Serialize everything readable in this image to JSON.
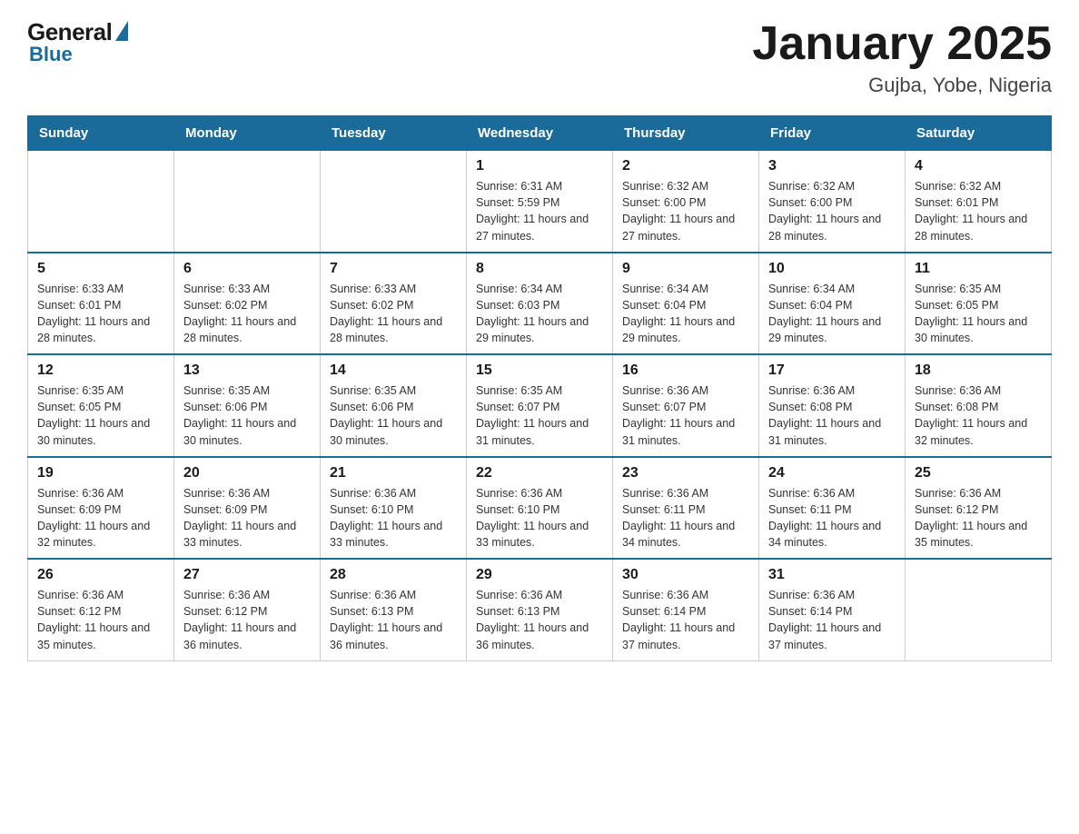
{
  "header": {
    "logo_general": "General",
    "logo_blue": "Blue",
    "title": "January 2025",
    "subtitle": "Gujba, Yobe, Nigeria"
  },
  "days_of_week": [
    "Sunday",
    "Monday",
    "Tuesday",
    "Wednesday",
    "Thursday",
    "Friday",
    "Saturday"
  ],
  "weeks": [
    [
      {
        "day": "",
        "info": ""
      },
      {
        "day": "",
        "info": ""
      },
      {
        "day": "",
        "info": ""
      },
      {
        "day": "1",
        "info": "Sunrise: 6:31 AM\nSunset: 5:59 PM\nDaylight: 11 hours and 27 minutes."
      },
      {
        "day": "2",
        "info": "Sunrise: 6:32 AM\nSunset: 6:00 PM\nDaylight: 11 hours and 27 minutes."
      },
      {
        "day": "3",
        "info": "Sunrise: 6:32 AM\nSunset: 6:00 PM\nDaylight: 11 hours and 28 minutes."
      },
      {
        "day": "4",
        "info": "Sunrise: 6:32 AM\nSunset: 6:01 PM\nDaylight: 11 hours and 28 minutes."
      }
    ],
    [
      {
        "day": "5",
        "info": "Sunrise: 6:33 AM\nSunset: 6:01 PM\nDaylight: 11 hours and 28 minutes."
      },
      {
        "day": "6",
        "info": "Sunrise: 6:33 AM\nSunset: 6:02 PM\nDaylight: 11 hours and 28 minutes."
      },
      {
        "day": "7",
        "info": "Sunrise: 6:33 AM\nSunset: 6:02 PM\nDaylight: 11 hours and 28 minutes."
      },
      {
        "day": "8",
        "info": "Sunrise: 6:34 AM\nSunset: 6:03 PM\nDaylight: 11 hours and 29 minutes."
      },
      {
        "day": "9",
        "info": "Sunrise: 6:34 AM\nSunset: 6:04 PM\nDaylight: 11 hours and 29 minutes."
      },
      {
        "day": "10",
        "info": "Sunrise: 6:34 AM\nSunset: 6:04 PM\nDaylight: 11 hours and 29 minutes."
      },
      {
        "day": "11",
        "info": "Sunrise: 6:35 AM\nSunset: 6:05 PM\nDaylight: 11 hours and 30 minutes."
      }
    ],
    [
      {
        "day": "12",
        "info": "Sunrise: 6:35 AM\nSunset: 6:05 PM\nDaylight: 11 hours and 30 minutes."
      },
      {
        "day": "13",
        "info": "Sunrise: 6:35 AM\nSunset: 6:06 PM\nDaylight: 11 hours and 30 minutes."
      },
      {
        "day": "14",
        "info": "Sunrise: 6:35 AM\nSunset: 6:06 PM\nDaylight: 11 hours and 30 minutes."
      },
      {
        "day": "15",
        "info": "Sunrise: 6:35 AM\nSunset: 6:07 PM\nDaylight: 11 hours and 31 minutes."
      },
      {
        "day": "16",
        "info": "Sunrise: 6:36 AM\nSunset: 6:07 PM\nDaylight: 11 hours and 31 minutes."
      },
      {
        "day": "17",
        "info": "Sunrise: 6:36 AM\nSunset: 6:08 PM\nDaylight: 11 hours and 31 minutes."
      },
      {
        "day": "18",
        "info": "Sunrise: 6:36 AM\nSunset: 6:08 PM\nDaylight: 11 hours and 32 minutes."
      }
    ],
    [
      {
        "day": "19",
        "info": "Sunrise: 6:36 AM\nSunset: 6:09 PM\nDaylight: 11 hours and 32 minutes."
      },
      {
        "day": "20",
        "info": "Sunrise: 6:36 AM\nSunset: 6:09 PM\nDaylight: 11 hours and 33 minutes."
      },
      {
        "day": "21",
        "info": "Sunrise: 6:36 AM\nSunset: 6:10 PM\nDaylight: 11 hours and 33 minutes."
      },
      {
        "day": "22",
        "info": "Sunrise: 6:36 AM\nSunset: 6:10 PM\nDaylight: 11 hours and 33 minutes."
      },
      {
        "day": "23",
        "info": "Sunrise: 6:36 AM\nSunset: 6:11 PM\nDaylight: 11 hours and 34 minutes."
      },
      {
        "day": "24",
        "info": "Sunrise: 6:36 AM\nSunset: 6:11 PM\nDaylight: 11 hours and 34 minutes."
      },
      {
        "day": "25",
        "info": "Sunrise: 6:36 AM\nSunset: 6:12 PM\nDaylight: 11 hours and 35 minutes."
      }
    ],
    [
      {
        "day": "26",
        "info": "Sunrise: 6:36 AM\nSunset: 6:12 PM\nDaylight: 11 hours and 35 minutes."
      },
      {
        "day": "27",
        "info": "Sunrise: 6:36 AM\nSunset: 6:12 PM\nDaylight: 11 hours and 36 minutes."
      },
      {
        "day": "28",
        "info": "Sunrise: 6:36 AM\nSunset: 6:13 PM\nDaylight: 11 hours and 36 minutes."
      },
      {
        "day": "29",
        "info": "Sunrise: 6:36 AM\nSunset: 6:13 PM\nDaylight: 11 hours and 36 minutes."
      },
      {
        "day": "30",
        "info": "Sunrise: 6:36 AM\nSunset: 6:14 PM\nDaylight: 11 hours and 37 minutes."
      },
      {
        "day": "31",
        "info": "Sunrise: 6:36 AM\nSunset: 6:14 PM\nDaylight: 11 hours and 37 minutes."
      },
      {
        "day": "",
        "info": ""
      }
    ]
  ]
}
